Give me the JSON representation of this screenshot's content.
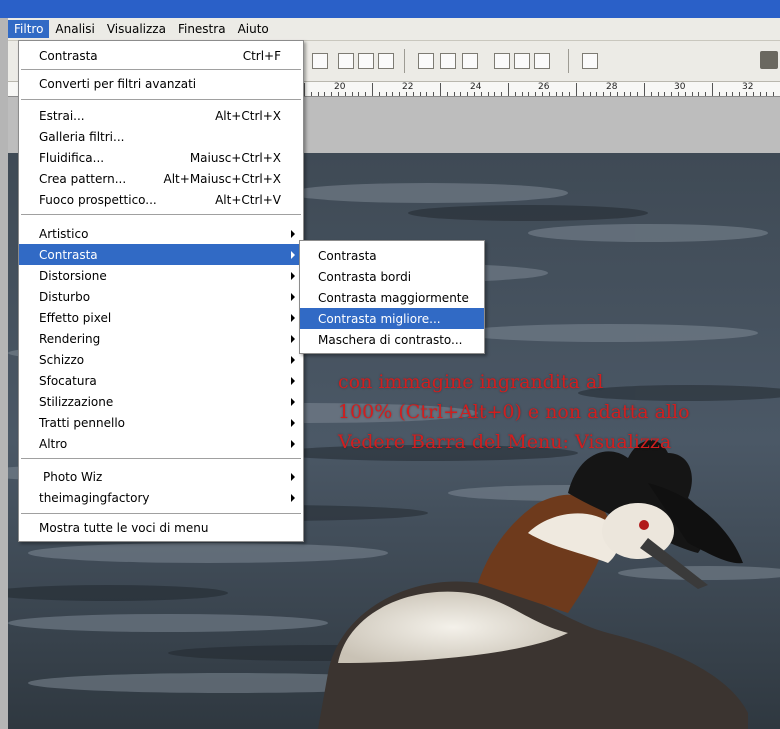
{
  "menubar": {
    "items": [
      "Filtro",
      "Analisi",
      "Visualizza",
      "Finestra",
      "Aiuto"
    ]
  },
  "ruler": {
    "labels": [
      "20",
      "22",
      "24",
      "26",
      "28",
      "30",
      "32"
    ]
  },
  "filter_menu": {
    "items": [
      {
        "label": "Contrasta",
        "shortcut": "Ctrl+F"
      },
      {
        "label": "Converti per filtri avanzati",
        "shortcut": ""
      },
      {
        "label": "Estrai...",
        "shortcut": "Alt+Ctrl+X"
      },
      {
        "label": "Galleria filtri...",
        "shortcut": ""
      },
      {
        "label": "Fluidifica...",
        "shortcut": "Maiusc+Ctrl+X"
      },
      {
        "label": "Crea pattern...",
        "shortcut": "Alt+Maiusc+Ctrl+X"
      },
      {
        "label": "Fuoco prospettico...",
        "shortcut": "Alt+Ctrl+V"
      },
      {
        "label": "Artistico",
        "shortcut": ""
      },
      {
        "label": "Contrasta",
        "shortcut": ""
      },
      {
        "label": "Distorsione",
        "shortcut": ""
      },
      {
        "label": "Disturbo",
        "shortcut": ""
      },
      {
        "label": "Effetto pixel",
        "shortcut": ""
      },
      {
        "label": "Rendering",
        "shortcut": ""
      },
      {
        "label": "Schizzo",
        "shortcut": ""
      },
      {
        "label": "Sfocatura",
        "shortcut": ""
      },
      {
        "label": "Stilizzazione",
        "shortcut": ""
      },
      {
        "label": "Tratti pennello",
        "shortcut": ""
      },
      {
        "label": "Altro",
        "shortcut": ""
      },
      {
        "label": "Photo Wiz",
        "shortcut": ""
      },
      {
        "label": "theimagingfactory",
        "shortcut": ""
      },
      {
        "label": "Mostra tutte le voci di menu",
        "shortcut": ""
      }
    ]
  },
  "submenu": {
    "items": [
      {
        "label": "Contrasta"
      },
      {
        "label": "Contrasta bordi"
      },
      {
        "label": "Contrasta maggiormente"
      },
      {
        "label": "Contrasta migliore..."
      },
      {
        "label": "Maschera di contrasto..."
      }
    ]
  },
  "overlay": {
    "lines": [
      "con immagine ingrandita al",
      "100% (Ctrl+Alt+0) e non adatta allo",
      "Vedere Barra del Menu: Visualizza"
    ]
  },
  "colors": {
    "menu_highlight": "#316ac5",
    "title_bar": "#2a60c8",
    "overlay_text": "#d11e1e"
  },
  "icons": [
    "align-top-edges-icon",
    "align-vertical-centers-icon",
    "align-bottom-edges-icon",
    "distribute-icon",
    "auto-align-icon",
    "palette-icon"
  ]
}
